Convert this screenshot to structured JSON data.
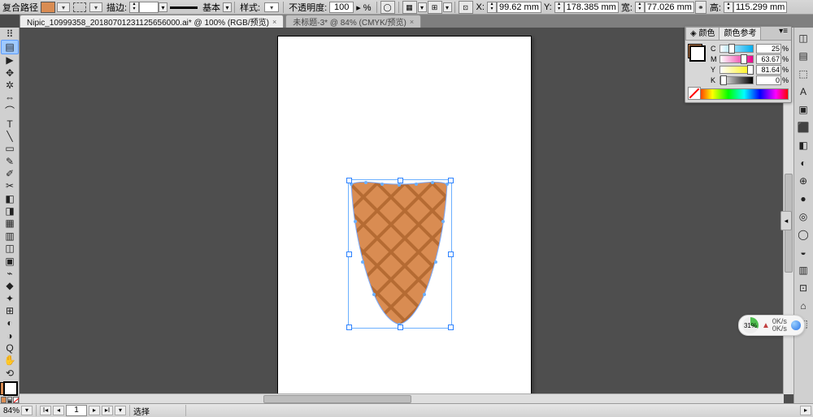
{
  "colors": {
    "fill": "#d98c52",
    "cone": "#d98c52",
    "coneDark": "#b56b33"
  },
  "controlbar": {
    "pathLabel": "复合路径",
    "strokeLabel": "描边:",
    "strokePreset": "基本",
    "styleLabel": "样式:",
    "opacityLabel": "不透明度:",
    "opacityValue": "100",
    "xLabel": "X:",
    "xValue": "99.62 mm",
    "yLabel": "Y:",
    "yValue": "178.385 mm",
    "wLabel": "宽:",
    "wValue": "77.026 mm",
    "hLabel": "高:",
    "hValue": "115.299 mm",
    "arrowSuffix": "▸ %"
  },
  "tabs": {
    "active": "Nipic_10999358_20180701231125656000.ai* @ 100% (RGB/预览)",
    "activeClose": "×",
    "secondary": "未标题-3* @ 84% (CMYK/预览)",
    "secondaryClose": "×"
  },
  "colorPanel": {
    "tab1": "◈ 颜色",
    "tab2": "颜色参考",
    "menu": "▾≡",
    "rows": [
      {
        "lab": "C",
        "val": "25",
        "pct": "%"
      },
      {
        "lab": "M",
        "val": "63.67",
        "pct": "%"
      },
      {
        "lab": "Y",
        "val": "81.64",
        "pct": "%"
      },
      {
        "lab": "K",
        "val": "0",
        "pct": "%"
      }
    ]
  },
  "status": {
    "zoom": "84%",
    "zoomDrop": "▾",
    "navFirst": "I◂",
    "navPrev": "◂",
    "artboard": "1",
    "navNext": "▸",
    "navLast": "▸I",
    "navDrop": "▾",
    "tool": "选择"
  },
  "pill": {
    "percent": "31%",
    "up": "▲",
    "l1": "0K/s",
    "l2": "0K/s"
  },
  "toolsLeft": [
    "▤",
    "▶",
    "✥",
    "✲",
    "⇔",
    "⌒",
    "T",
    "╲",
    "▭",
    "✎",
    "✐",
    "✂",
    "◧",
    "◨",
    "▦",
    "▥",
    "◫",
    "▣",
    "⌁",
    "◆",
    "✦",
    "⊞",
    "◐",
    "◑",
    "Q",
    "✋",
    "⟲"
  ],
  "toolsRight": [
    "◫",
    "▤",
    "⬚",
    "A",
    "▣",
    "⬛",
    "◧",
    "◐",
    "⊕",
    "●",
    "◎",
    "◯",
    "◒",
    "▥",
    "⊡",
    "⌂",
    "⬚"
  ],
  "closeIcon": "✕",
  "minIcon": "–",
  "ddArrow": "▾"
}
